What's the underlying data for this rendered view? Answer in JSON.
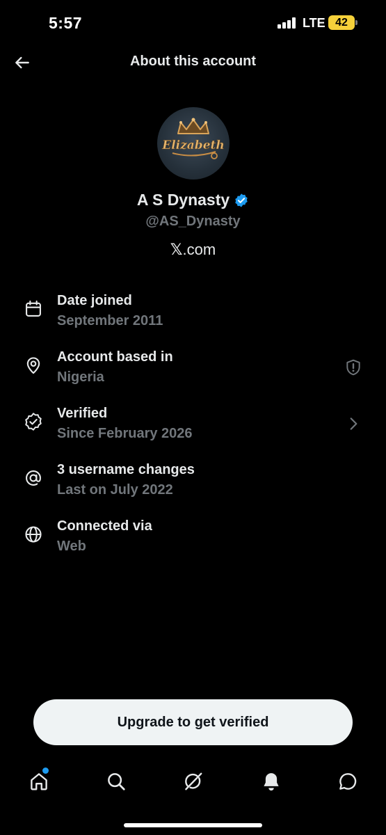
{
  "status_bar": {
    "time": "5:57",
    "network": "LTE",
    "battery": "42",
    "battery_color": "#f6d13a"
  },
  "header": {
    "back_icon": "arrow-left-icon",
    "title": "About this account"
  },
  "profile": {
    "avatar_text": "Elizabeth",
    "display_name": "A S Dynasty",
    "verified_badge_color": "#1d9bf0",
    "handle": "@AS_Dynasty",
    "domain_mark": "𝕏",
    "domain_suffix": ".com"
  },
  "info": {
    "date_joined": {
      "icon": "calendar-icon",
      "title": "Date joined",
      "value": "September 2011"
    },
    "based_in": {
      "icon": "location-pin-icon",
      "title": "Account based in",
      "value": "Nigeria",
      "trail_icon": "shield-alert-icon"
    },
    "verified": {
      "icon": "verified-badge-icon",
      "title": "Verified",
      "value": "Since February 2026",
      "trail_icon": "chevron-right-icon"
    },
    "username_changes": {
      "icon": "at-sign-icon",
      "title": "3 username changes",
      "value": "Last on July 2022"
    },
    "connected_via": {
      "icon": "globe-icon",
      "title": "Connected via",
      "value": "Web"
    }
  },
  "upgrade_button": {
    "label": "Upgrade to get verified"
  },
  "bottom_nav": {
    "items": [
      "home-icon",
      "search-icon",
      "grok-icon",
      "notifications-bell-icon",
      "messages-icon"
    ],
    "notification_dot_color": "#1d9bf0"
  }
}
